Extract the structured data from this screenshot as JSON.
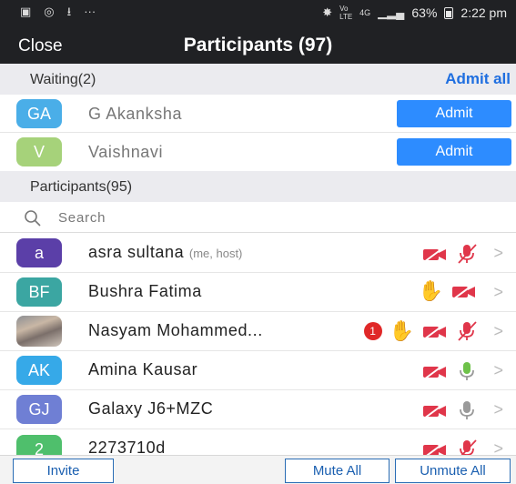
{
  "status_bar": {
    "left_icons": [
      "gallery-icon",
      "whatsapp-icon",
      "download-icon",
      "more-dots-icon"
    ],
    "network_lte": "Vo LTE",
    "network_4g": "4G",
    "battery": "63%",
    "time": "2:22 pm"
  },
  "header": {
    "close_label": "Close",
    "title": "Participants (97)"
  },
  "waiting": {
    "label": "Waiting(2)",
    "admit_all_label": "Admit all",
    "items": [
      {
        "initials": "GA",
        "name": "G Akanksha",
        "color": "#4aaee8",
        "button": "Admit"
      },
      {
        "initials": "V",
        "name": "Vaishnavi",
        "color": "#a6d27a",
        "button": "Admit"
      }
    ]
  },
  "participants": {
    "label": "Participants(95)",
    "search_placeholder": "Search",
    "items": [
      {
        "initials": "a",
        "name": "asra sultana",
        "tag": "(me, host)",
        "color": "#5b3fa8",
        "hand": false,
        "badge": "",
        "video": "off",
        "mic": "muted"
      },
      {
        "initials": "BF",
        "name": "Bushra Fatima",
        "tag": "",
        "color": "#3ba6a2",
        "hand": true,
        "badge": "",
        "video": "off",
        "mic": "none"
      },
      {
        "initials": "",
        "name": "Nasyam Mohammed...",
        "tag": "",
        "color": "photo",
        "hand": true,
        "badge": "1",
        "video": "off",
        "mic": "muted"
      },
      {
        "initials": "AK",
        "name": "Amina Kausar",
        "tag": "",
        "color": "#36a9e8",
        "hand": false,
        "badge": "",
        "video": "off",
        "mic": "on"
      },
      {
        "initials": "GJ",
        "name": "Galaxy J6+MZC",
        "tag": "",
        "color": "#6f7fd4",
        "hand": false,
        "badge": "",
        "video": "off",
        "mic": "idle"
      },
      {
        "initials": "2",
        "name": "2273710d",
        "tag": "",
        "color": "#4fbf6c",
        "hand": false,
        "badge": "",
        "video": "off",
        "mic": "muted"
      }
    ]
  },
  "toolbar": {
    "invite": "Invite",
    "mute_all": "Mute All",
    "unmute_all": "Unmute All"
  },
  "colors": {
    "accent": "#2d8cff",
    "video_off": "#e0364a",
    "mic_on": "#6ec24a"
  }
}
